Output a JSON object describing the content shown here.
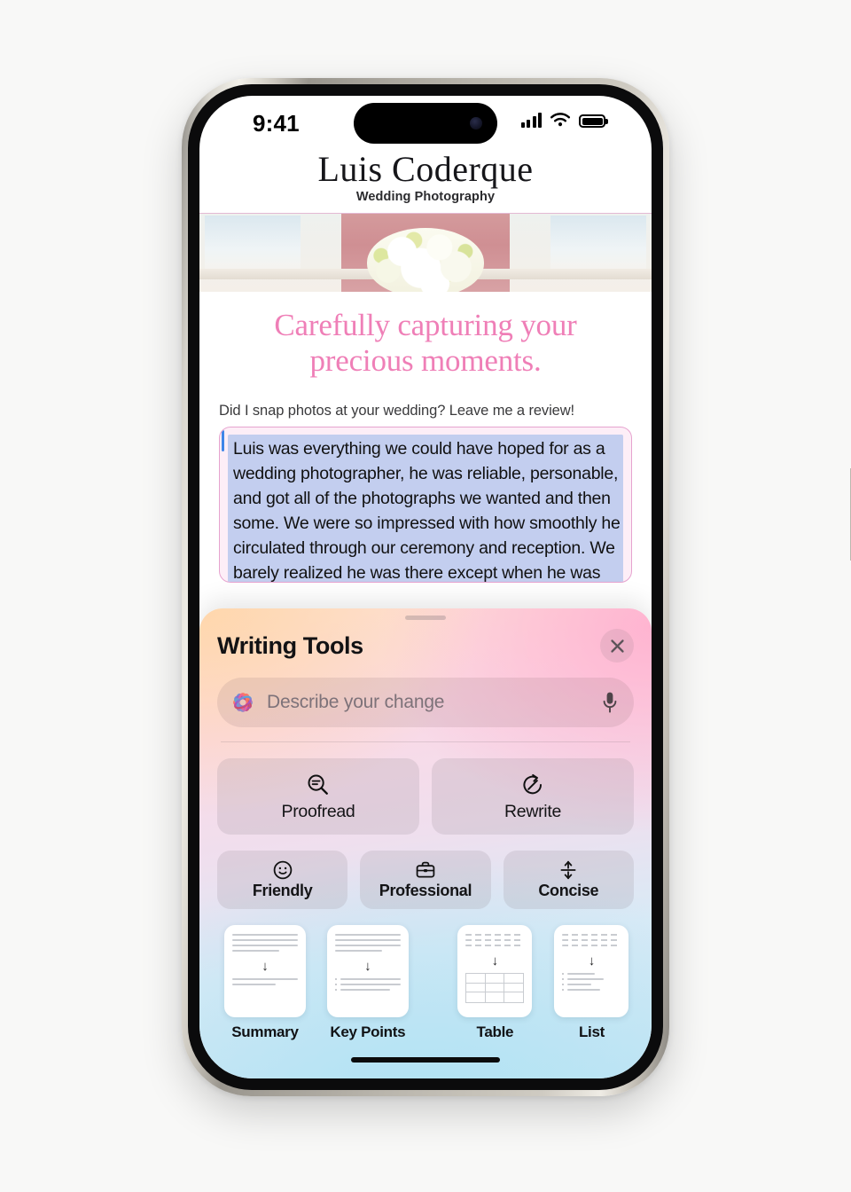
{
  "status_bar": {
    "time": "9:41",
    "cellular_icon": "signal-bars-icon",
    "wifi_icon": "wifi-icon",
    "battery_icon": "battery-full-icon"
  },
  "site": {
    "title": "Luis Coderque",
    "subtitle": "Wedding Photography",
    "headline_line1": "Carefully capturing your",
    "headline_line2": "precious moments.",
    "headline_color": "#ef7fb7",
    "review_prompt": "Did I snap photos at your wedding? Leave me a review!",
    "review_text": "Luis was everything we could have hoped for as a wedding photographer, he was reliable, personable, and got all of the photographs we wanted and then some. We were so impressed with how smoothly he circulated through our ceremony and reception. We barely realized he was there except when he was very",
    "selection_highlight_color": "#c3ceef",
    "caret_color": "#3e86e8",
    "box_border_color": "#e6a3cf"
  },
  "writing_tools": {
    "title": "Writing Tools",
    "close_icon": "close-icon",
    "grabber": "sheet-drag-handle",
    "prompt_field": {
      "placeholder": "Describe your change",
      "value": "",
      "leading_icon": "apple-intelligence-icon",
      "trailing_icon": "microphone-icon"
    },
    "primary_actions": [
      {
        "label": "Proofread",
        "icon": "proofread-magnifier-icon"
      },
      {
        "label": "Rewrite",
        "icon": "rewrite-circle-arrow-icon"
      }
    ],
    "tone_actions": [
      {
        "label": "Friendly",
        "icon": "smiley-face-icon"
      },
      {
        "label": "Professional",
        "icon": "briefcase-icon"
      },
      {
        "label": "Concise",
        "icon": "compress-arrows-icon"
      }
    ],
    "format_actions": [
      {
        "label": "Summary",
        "icon": "document-summary-icon"
      },
      {
        "label": "Key Points",
        "icon": "document-key-points-icon"
      },
      {
        "label": "Table",
        "icon": "document-table-icon"
      },
      {
        "label": "List",
        "icon": "document-list-icon"
      }
    ]
  },
  "home_indicator": "home-indicator"
}
